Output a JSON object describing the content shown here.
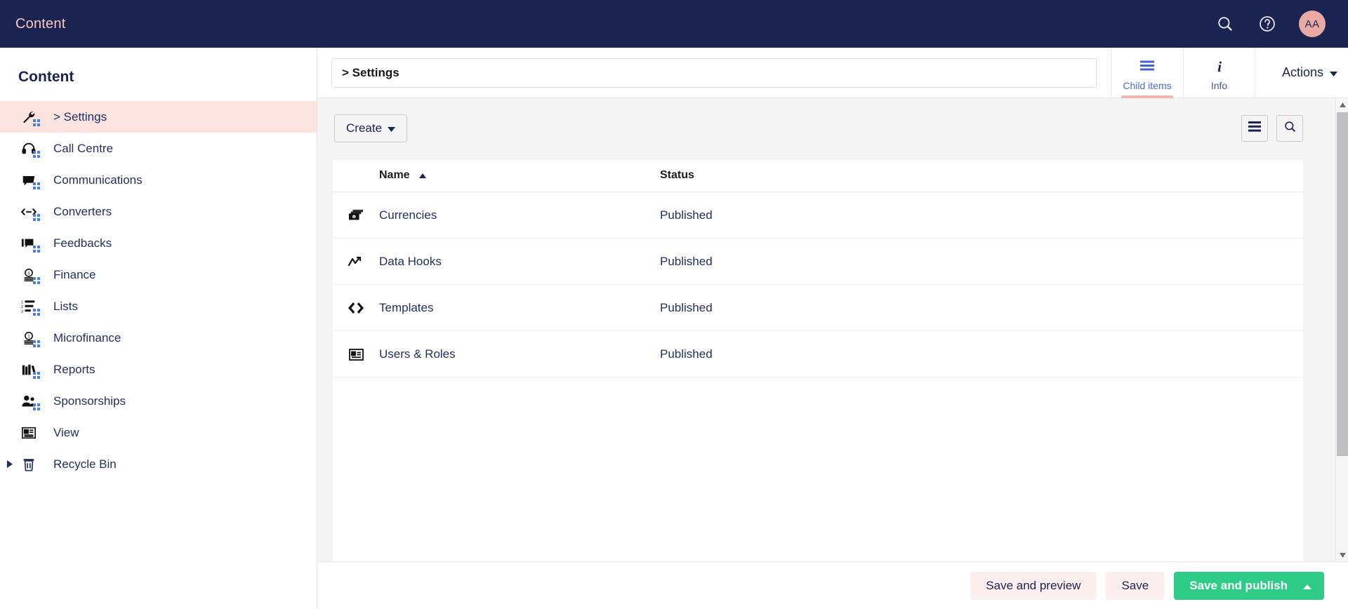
{
  "topbar": {
    "title": "Content",
    "search_icon": "search-icon",
    "help_icon": "help-circle-icon",
    "avatar_initials": "AA"
  },
  "sidebar": {
    "heading": "Content",
    "items": [
      {
        "label": "> Settings",
        "icon": "wrench-icon",
        "active": true,
        "caret": false
      },
      {
        "label": "Call Centre",
        "icon": "headset-icon",
        "active": false,
        "caret": false
      },
      {
        "label": "Communications",
        "icon": "speech-bubble-icon",
        "active": false,
        "caret": false
      },
      {
        "label": "Converters",
        "icon": "code-arrows-icon",
        "active": false,
        "caret": false
      },
      {
        "label": "Feedbacks",
        "icon": "feedback-icon",
        "active": false,
        "caret": false
      },
      {
        "label": "Finance",
        "icon": "coins-dollar-icon",
        "active": false,
        "caret": false
      },
      {
        "label": "Lists",
        "icon": "numbered-list-icon",
        "active": false,
        "caret": false
      },
      {
        "label": "Microfinance",
        "icon": "coins-one-icon",
        "active": false,
        "caret": false
      },
      {
        "label": "Reports",
        "icon": "books-icon",
        "active": false,
        "caret": false
      },
      {
        "label": "Sponsorships",
        "icon": "people-icon",
        "active": false,
        "caret": false
      },
      {
        "label": "View",
        "icon": "document-view-icon",
        "active": false,
        "caret": false
      },
      {
        "label": "Recycle Bin",
        "icon": "trash-icon",
        "active": false,
        "caret": true
      }
    ]
  },
  "header": {
    "breadcrumb": "> Settings",
    "tabs": [
      {
        "label": "Child items",
        "icon": "list-lines-icon",
        "active": true
      },
      {
        "label": "Info",
        "icon": "info-italic-icon",
        "active": false
      }
    ],
    "actions_label": "Actions",
    "actions_caret": "chevron-down-icon"
  },
  "toolbar": {
    "create_label": "Create",
    "create_caret": "chevron-down-icon",
    "list_view_icon": "list-view-icon",
    "search_icon": "search-icon"
  },
  "table": {
    "columns": [
      "",
      "Name",
      "Status"
    ],
    "sort_column": "Name",
    "sort_direction": "asc",
    "sort_icon": "triangle-up-icon",
    "rows": [
      {
        "icon": "money-stack-icon",
        "name": "Currencies",
        "status": "Published"
      },
      {
        "icon": "trend-line-icon",
        "name": "Data Hooks",
        "status": "Published"
      },
      {
        "icon": "angle-brackets-icon",
        "name": "Templates",
        "status": "Published"
      },
      {
        "icon": "id-card-icon",
        "name": "Users & Roles",
        "status": "Published"
      }
    ]
  },
  "footer": {
    "save_preview_label": "Save and preview",
    "save_label": "Save",
    "publish_label": "Save and publish",
    "publish_caret": "chevron-up-icon"
  },
  "colors": {
    "navy": "#1b2450",
    "salmon": "#f3b7ae",
    "pink_bg": "#fbe3e0",
    "green": "#2ecc87",
    "link_blue": "#23305c",
    "dots_blue": "#4a7fe0"
  }
}
